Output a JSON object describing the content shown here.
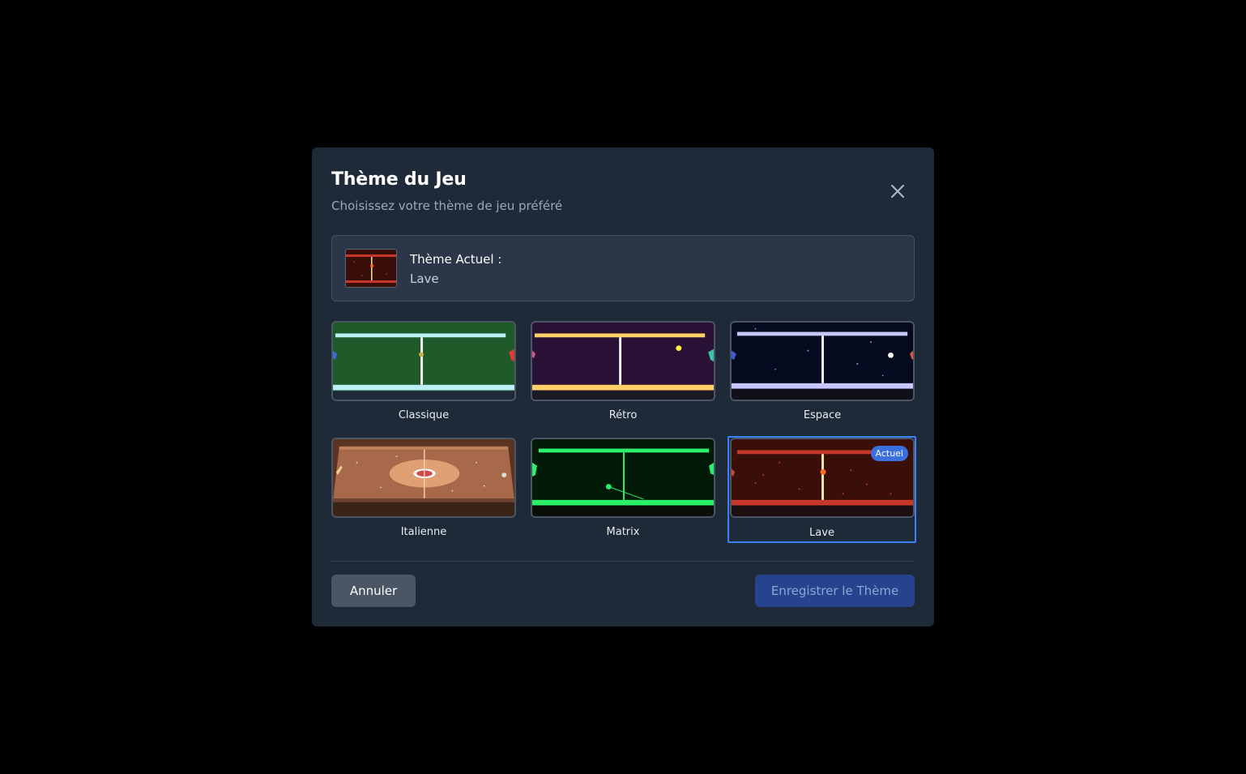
{
  "dialog": {
    "title": "Thème du Jeu",
    "subtitle": "Choisissez votre thème de jeu préféré",
    "close_icon": "close-icon"
  },
  "current": {
    "label": "Thème Actuel :",
    "value": "Lave"
  },
  "themes": [
    {
      "label": "Classique",
      "bg": "#1f5a2a",
      "accent": "#7ee3f0"
    },
    {
      "label": "Rétro",
      "bg": "#2a1236",
      "accent": "#ffd166"
    },
    {
      "label": "Espace",
      "bg": "#060a1e",
      "accent": "#b9b7ff"
    },
    {
      "label": "Italienne",
      "bg": "#a8694a",
      "accent": "#7a4a30"
    },
    {
      "label": "Matrix",
      "bg": "#021a08",
      "accent": "#2cf06a"
    },
    {
      "label": "Lave",
      "bg": "#3a0f0a",
      "accent": "#c8382a"
    }
  ],
  "selected_badge": "Actuel",
  "buttons": {
    "cancel": "Annuler",
    "save": "Enregistrer le Thème"
  }
}
